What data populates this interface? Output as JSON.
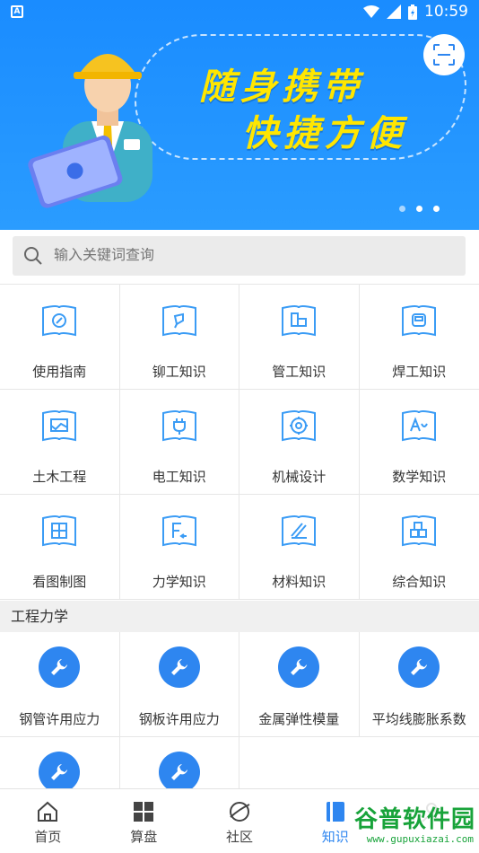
{
  "status": {
    "time": "10:59",
    "notification_icon": "a-icon"
  },
  "banner": {
    "line1": "随身携带",
    "line2": "快捷方便",
    "dots": 3,
    "active_dot": 2
  },
  "search": {
    "placeholder": "输入关键词查询"
  },
  "knowledge": [
    {
      "label": "使用指南",
      "icon": "compass-book-icon"
    },
    {
      "label": "铆工知识",
      "icon": "rivet-book-icon"
    },
    {
      "label": "管工知识",
      "icon": "pipe-book-icon"
    },
    {
      "label": "焊工知识",
      "icon": "weld-mask-book-icon"
    },
    {
      "label": "土木工程",
      "icon": "civil-book-icon"
    },
    {
      "label": "电工知识",
      "icon": "plug-book-icon"
    },
    {
      "label": "机械设计",
      "icon": "gear-book-icon"
    },
    {
      "label": "数学知识",
      "icon": "math-book-icon"
    },
    {
      "label": "看图制图",
      "icon": "drawing-book-icon"
    },
    {
      "label": "力学知识",
      "icon": "force-book-icon"
    },
    {
      "label": "材料知识",
      "icon": "material-book-icon"
    },
    {
      "label": "综合知识",
      "icon": "blocks-book-icon"
    }
  ],
  "section_title": "工程力学",
  "mechanics": [
    {
      "label": "钢管许用应力"
    },
    {
      "label": "钢板许用应力"
    },
    {
      "label": "金属弹性模量"
    },
    {
      "label": "平均线膨胀系数"
    },
    {
      "label": ""
    },
    {
      "label": ""
    }
  ],
  "tabs": [
    {
      "label": "首页",
      "icon": "home-icon"
    },
    {
      "label": "算盘",
      "icon": "grid-icon"
    },
    {
      "label": "社区",
      "icon": "planet-icon"
    },
    {
      "label": "知识",
      "icon": "book-icon",
      "active": true
    },
    {
      "label": "",
      "icon": "profile-icon"
    }
  ],
  "watermark": {
    "text": "谷普软件园",
    "url": "www.gupuxiazai.com"
  },
  "colors": {
    "accent": "#2e86f0",
    "banner": "#1a8cff",
    "slogan": "#ffe600"
  }
}
